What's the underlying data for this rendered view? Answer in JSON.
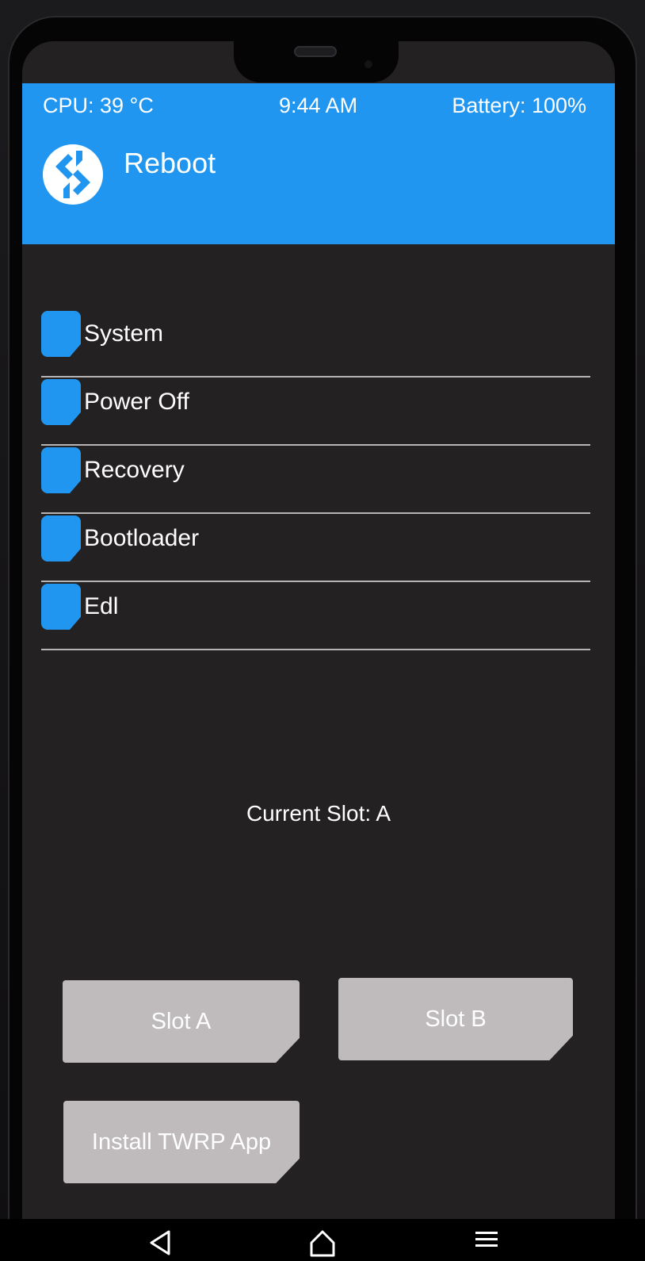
{
  "status_bar": {
    "cpu": "CPU: 39 °C",
    "time": "9:44 AM",
    "battery": "Battery: 100%"
  },
  "header": {
    "title": "Reboot",
    "logo_icon": "twrp-logo-icon"
  },
  "reboot_options": [
    {
      "label": "System"
    },
    {
      "label": "Power Off"
    },
    {
      "label": "Recovery"
    },
    {
      "label": "Bootloader"
    },
    {
      "label": "Edl"
    }
  ],
  "current_slot": "Current Slot: A",
  "buttons": {
    "slot_a": "Slot A",
    "slot_b": "Slot B",
    "install_app": "Install TWRP App"
  },
  "navbar": {
    "icons": [
      "back-icon",
      "home-icon",
      "menu-icon"
    ]
  },
  "colors": {
    "accent": "#2196f0",
    "background": "#242122",
    "button": "#bfbbbd",
    "divider": "#b7b4b6"
  }
}
